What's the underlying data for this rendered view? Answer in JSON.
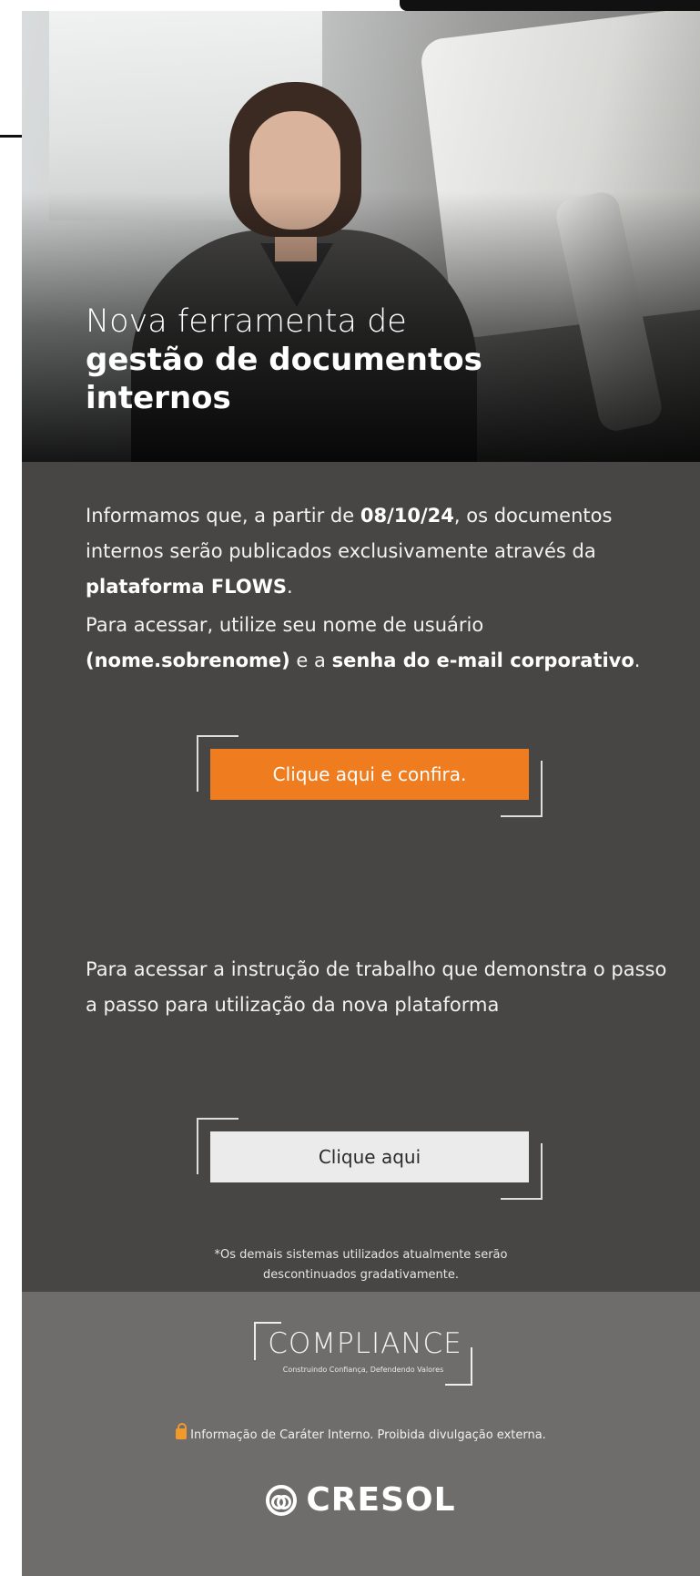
{
  "hero": {
    "title_line1": "Nova ferramenta de",
    "title_line2": "gestão de documentos",
    "title_line3": "internos"
  },
  "intro": {
    "part1": "Informamos que, a partir de ",
    "date": "08/10/24",
    "part2": ", os documentos internos serão publicados exclusivamente através da ",
    "platform": "plataforma FLOWS",
    "part3": "."
  },
  "access": {
    "part1": "Para acessar, utilize seu nome de usuário ",
    "username": "(nome.sobrenome)",
    "part2": " e a ",
    "password": "senha do e-mail corporativo",
    "part3": "."
  },
  "primary_button": {
    "label": "Clique aqui e confira."
  },
  "instruction": {
    "text": "Para acessar a instrução de trabalho que demonstra o passo a passo para utilização da nova plataforma"
  },
  "secondary_button": {
    "label": "Clique aqui"
  },
  "footnote": {
    "line1": "*Os demais sistemas utilizados atualmente serão",
    "line2": "descontinuados gradativamente."
  },
  "footer": {
    "compliance_word": "COMPLIANCE",
    "compliance_tagline": "Construindo Confiança, Defendendo Valores",
    "notice": "Informação de Caráter Interno. Proibida divulgação externa.",
    "brand": "CRESOL"
  },
  "colors": {
    "accent": "#ef7d1f",
    "content_bg": "#474645",
    "footer_bg": "#6e6d6c"
  }
}
